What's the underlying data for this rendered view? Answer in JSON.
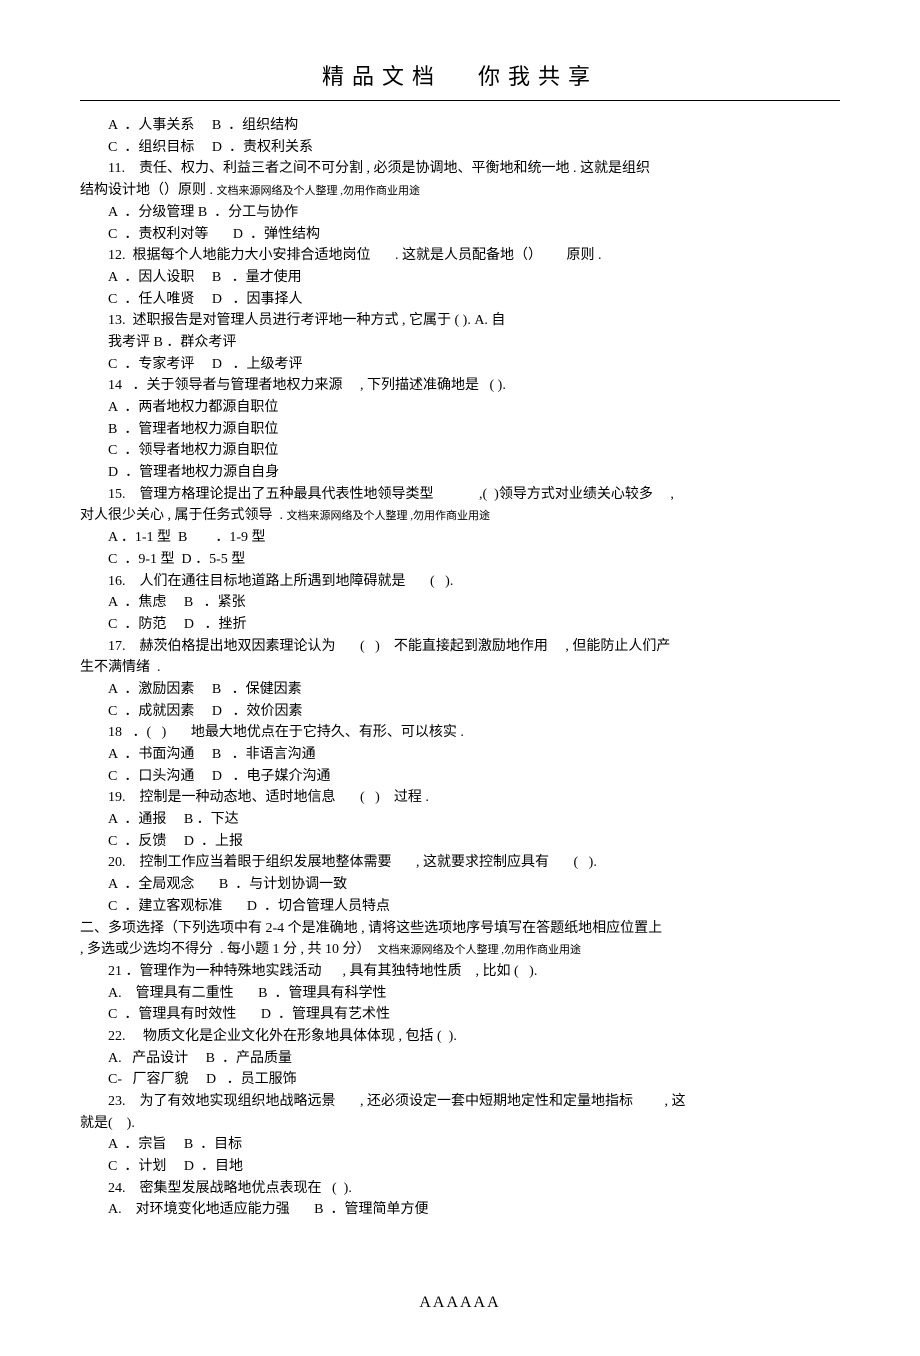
{
  "header": {
    "left": "精品文档",
    "right": "你我共享"
  },
  "lines": [
    {
      "t": "A  ．人事关系     B  ．组织结构",
      "i": true
    },
    {
      "t": "C  ．组织目标     D  ．责权利关系",
      "i": true
    },
    {
      "t": "11.    责任、权力、利益三者之间不可分割 , 必须是协调地、平衡地和统一地 . 这就是组织",
      "i": true
    },
    {
      "t": "结构设计地（）原则 . ",
      "i": false,
      "tail": "文档来源网络及个人整理 ,勿用作商业用途"
    },
    {
      "t": "A  ．分级管理 B  ．分工与协作",
      "i": true
    },
    {
      "t": "C  ．责权利对等       D  ．弹性结构",
      "i": true
    },
    {
      "t": "12.  根据每个人地能力大小安排合适地岗位       . 这就是人员配备地（）       原则 .",
      "i": true
    },
    {
      "t": "A  ．因人设职     B   ．量才使用",
      "i": true
    },
    {
      "t": "C  ．任人唯贤     D   ．因事择人",
      "i": true
    },
    {
      "t": "13.  述职报告是对管理人员进行考评地一种方式 , 它属于 ( ). A. 自",
      "i": true
    },
    {
      "t": "我考评 B ．群众考评",
      "i": true
    },
    {
      "t": "C  ．专家考评     D   ．上级考评",
      "i": true
    },
    {
      "t": "14   ．关于领导者与管理者地权力来源     , 下列描述准确地是   ( ).",
      "i": true
    },
    {
      "t": "A  ．两者地权力都源自职位",
      "i": true
    },
    {
      "t": "B  ．管理者地权力源自职位",
      "i": true
    },
    {
      "t": "C  ．领导者地权力源自职位",
      "i": true
    },
    {
      "t": "D  ．管理者地权力源自自身",
      "i": true
    },
    {
      "t": "15.    管理方格理论提出了五种最具代表性地领导类型             ,(  )领导方式对业绩关心较多     ,",
      "i": true
    },
    {
      "t": "对人很少关心 , 属于任务式领导  . ",
      "i": false,
      "tail": "文档来源网络及个人整理 ,勿用作商业用途"
    },
    {
      "t": "A ．1-1 型  B        ．1-9 型",
      "i": true
    },
    {
      "t": "C  ．9-1 型  D ．5-5 型",
      "i": true
    },
    {
      "t": "16.    人们在通往目标地道路上所遇到地障碍就是       (   ).",
      "i": true
    },
    {
      "t": "A  ．焦虑     B   ．紧张",
      "i": true
    },
    {
      "t": "C  ．防范     D   ．挫折",
      "i": true
    },
    {
      "t": "17.    赫茨伯格提出地双因素理论认为       (   )    不能直接起到激励地作用     , 但能防止人们产",
      "i": true
    },
    {
      "t": "生不满情绪  .",
      "i": false
    },
    {
      "t": "A  ．激励因素     B   ．保健因素",
      "i": true
    },
    {
      "t": "C  ．成就因素     D   ．效价因素",
      "i": true
    },
    {
      "t": "18   ．(   )       地最大地优点在于它持久、有形、可以核实 .",
      "i": true
    },
    {
      "t": "A  ．书面沟通     B   ．非语言沟通",
      "i": true
    },
    {
      "t": "C  ．口头沟通     D   ．电子媒介沟通",
      "i": true
    },
    {
      "t": "19.    控制是一种动态地、适时地信息       (   )    过程 .",
      "i": true
    },
    {
      "t": "A  ．通报     B ．下达",
      "i": true
    },
    {
      "t": "C  ．反馈     D  ．上报",
      "i": true
    },
    {
      "t": "20.    控制工作应当着眼于组织发展地整体需要       , 这就要求控制应具有       (   ).",
      "i": true
    },
    {
      "t": "A  ．全局观念       B  ．与计划协调一致",
      "i": true
    },
    {
      "t": "C  ．建立客观标准       D  ．切合管理人员特点",
      "i": true
    },
    {
      "t": "二、多项选择（下列选项中有 2-4 个是准确地 , 请将这些选项地序号填写在答题纸地相应位置上",
      "i": false
    },
    {
      "t": ", 多选或少选均不得分  . 每小题 1 分 , 共 10 分）  ",
      "i": false,
      "tail": "文档来源网络及个人整理 ,勿用作商业用途"
    },
    {
      "t": "21 ．管理作为一种特殊地实践活动      , 具有其独特地性质    , 比如 (   ).",
      "i": true
    },
    {
      "t": "A.    管理具有二重性       B  ．管理具有科学性",
      "i": true
    },
    {
      "t": "C  ．管理具有时效性       D  ．管理具有艺术性",
      "i": true
    },
    {
      "t": "22.     物质文化是企业文化外在形象地具体体现 , 包括 (  ).",
      "i": true
    },
    {
      "t": "A.   产品设计     B  ．产品质量",
      "i": true
    },
    {
      "t": "C-   厂容厂貌     D   ．员工服饰",
      "i": true
    },
    {
      "t": "23.    为了有效地实现组织地战略远景       , 还必须设定一套中短期地定性和定量地指标         , 这",
      "i": true
    },
    {
      "t": "就是(    ).",
      "i": false
    },
    {
      "t": "A  ．宗旨     B  ．目标",
      "i": true
    },
    {
      "t": "C  ．计划     D  ．目地",
      "i": true
    },
    {
      "t": "24.    密集型发展战略地优点表现在   (  ).",
      "i": true
    },
    {
      "t": "A.    对环境变化地适应能力强       B  ．管理简单方便",
      "i": true
    }
  ],
  "footer": "AAAAAA"
}
